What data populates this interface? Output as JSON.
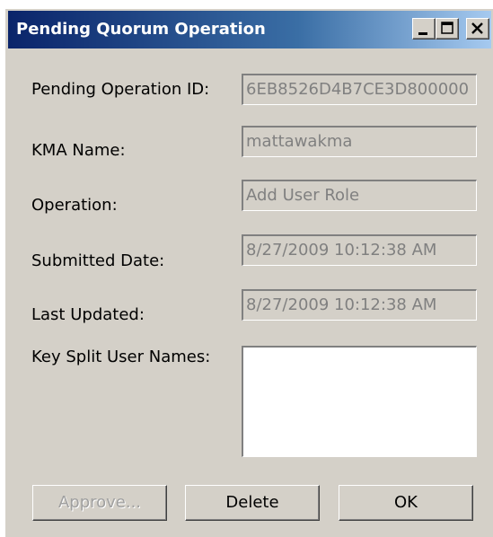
{
  "window": {
    "title": "Pending Quorum Operation",
    "controls": {
      "minimize_icon": "minimize-icon",
      "maximize_icon": "maximize-icon",
      "close_icon": "close-icon"
    }
  },
  "form": {
    "pending_operation_id": {
      "label": "Pending Operation ID:",
      "value": "6EB8526D4B7CE3D800000"
    },
    "kma_name": {
      "label": "KMA Name:",
      "value": "mattawakma"
    },
    "operation": {
      "label": "Operation:",
      "value": "Add User Role"
    },
    "submitted_date": {
      "label": "Submitted Date:",
      "value": "8/27/2009 10:12:38 AM"
    },
    "last_updated": {
      "label": "Last Updated:",
      "value": "8/27/2009 10:12:38 AM"
    },
    "key_split_user_names": {
      "label": "Key Split User Names:"
    }
  },
  "buttons": {
    "approve": "Approve...",
    "delete": "Delete",
    "ok": "OK"
  },
  "colors": {
    "title_gradient_start": "#0a246a",
    "title_gradient_end": "#a6caf0",
    "dialog_face": "#d4d0c8",
    "disabled_text": "#808080"
  }
}
